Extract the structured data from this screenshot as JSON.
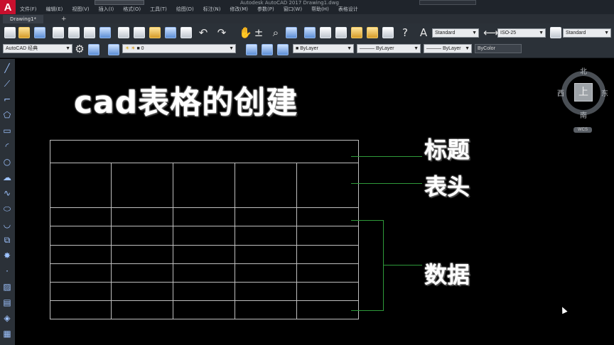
{
  "app": {
    "logo": "A",
    "window_title": "Autodesk AutoCAD 2017   Drawing1.dwg",
    "menu": [
      "文件(F)",
      "编辑(E)",
      "视图(V)",
      "插入(I)",
      "格式(O)",
      "工具(T)",
      "绘图(D)",
      "标注(N)",
      "修改(M)",
      "参数(P)",
      "窗口(W)",
      "帮助(H)",
      "表格设计"
    ]
  },
  "tabs": {
    "active": "Drawing1*",
    "add": "+"
  },
  "toolbar": {
    "text_style": "Standard",
    "dim_style": "ISO-25",
    "table_style": "Standard",
    "workspace": "AutoCAD 经典",
    "layer": "0",
    "color": "ByLayer",
    "linetype": "ByLayer",
    "lineweight": "ByLayer",
    "plot_style": "ByColor"
  },
  "canvas": {
    "heading": "cad表格的创建",
    "callouts": {
      "title": "标题",
      "header": "表头",
      "data": "数据"
    }
  },
  "viewcube": {
    "north": "北",
    "south": "南",
    "east": "东",
    "west": "西",
    "face": "上",
    "wcs": "WCS"
  }
}
